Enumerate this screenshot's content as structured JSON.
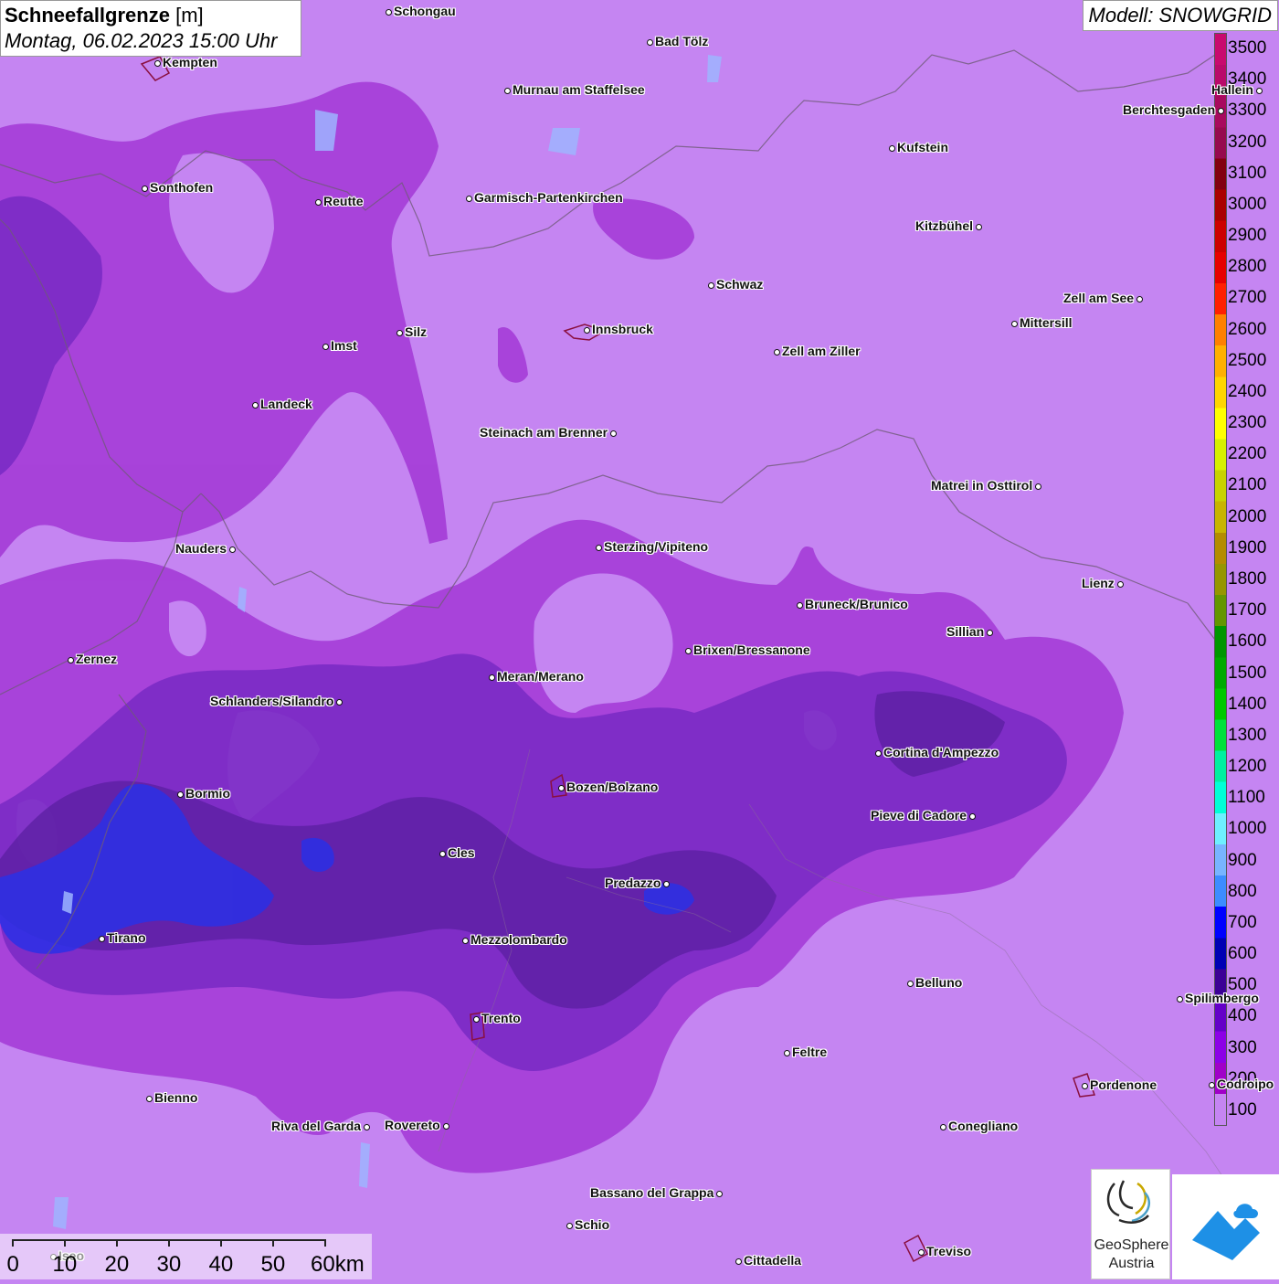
{
  "header": {
    "title": "Schneefallgrenze",
    "unit": "[m]",
    "datetime": "Montag, 06.02.2023 15:00 Uhr"
  },
  "model": {
    "label": "Modell: SNOWGRID"
  },
  "legend": {
    "levels": [
      "3500",
      "3400",
      "3300",
      "3200",
      "3100",
      "3000",
      "2900",
      "2800",
      "2700",
      "2600",
      "2500",
      "2400",
      "2300",
      "2200",
      "2100",
      "2000",
      "1900",
      "1800",
      "1700",
      "1600",
      "1500",
      "1400",
      "1300",
      "1200",
      "1100",
      "1000",
      "900",
      "800",
      "700",
      "600",
      "500",
      "400",
      "300",
      "200",
      "100"
    ],
    "colors": [
      "#c80a6e",
      "#b90a6a",
      "#a80a5e",
      "#960a4e",
      "#820010",
      "#aa0000",
      "#cc0000",
      "#e60000",
      "#ff2000",
      "#ff8000",
      "#ffb000",
      "#ffd500",
      "#ffff00",
      "#d7f000",
      "#c8d200",
      "#c8b400",
      "#b48c00",
      "#969600",
      "#649600",
      "#009600",
      "#00aa00",
      "#00c800",
      "#00e13c",
      "#00f0a0",
      "#00ffd7",
      "#6ef0ff",
      "#78b4ff",
      "#3c8cff",
      "#0000ff",
      "#0000b4",
      "#3c0096",
      "#6400c8",
      "#8c00e6",
      "#a000c8",
      "#c585f2"
    ]
  },
  "cities": [
    {
      "name": "Schongau",
      "dot": "left"
    },
    {
      "name": "Bad Tölz",
      "dot": "left"
    },
    {
      "name": "Kempten",
      "dot": "left"
    },
    {
      "name": "Murnau am Staffelsee",
      "dot": "left"
    },
    {
      "name": "Hallein",
      "dot": "right"
    },
    {
      "name": "Berchtesgaden",
      "dot": "right"
    },
    {
      "name": "Kufstein",
      "dot": "left"
    },
    {
      "name": "Sonthofen",
      "dot": "left"
    },
    {
      "name": "Reutte",
      "dot": "left"
    },
    {
      "name": "Garmisch-Partenkirchen",
      "dot": "left"
    },
    {
      "name": "Kitzbühel",
      "dot": "right"
    },
    {
      "name": "Schwaz",
      "dot": "left"
    },
    {
      "name": "Zell am See",
      "dot": "right"
    },
    {
      "name": "Innsbruck",
      "dot": "left"
    },
    {
      "name": "Mittersill",
      "dot": "left"
    },
    {
      "name": "Silz",
      "dot": "left"
    },
    {
      "name": "Imst",
      "dot": "left"
    },
    {
      "name": "Zell am Ziller",
      "dot": "left"
    },
    {
      "name": "Landeck",
      "dot": "left"
    },
    {
      "name": "Steinach am Brenner",
      "dot": "right"
    },
    {
      "name": "Matrei in Osttirol",
      "dot": "right"
    },
    {
      "name": "Nauders",
      "dot": "right"
    },
    {
      "name": "Sterzing/Vipiteno",
      "dot": "left"
    },
    {
      "name": "Lienz",
      "dot": "right"
    },
    {
      "name": "Bruneck/Brunico",
      "dot": "left"
    },
    {
      "name": "Sillian",
      "dot": "right"
    },
    {
      "name": "Zernez",
      "dot": "left"
    },
    {
      "name": "Brixen/Bressanone",
      "dot": "left"
    },
    {
      "name": "Meran/Merano",
      "dot": "left"
    },
    {
      "name": "Schlanders/Silandro",
      "dot": "right"
    },
    {
      "name": "Cortina d'Ampezzo",
      "dot": "left"
    },
    {
      "name": "Bozen/Bolzano",
      "dot": "left"
    },
    {
      "name": "Bormio",
      "dot": "left"
    },
    {
      "name": "Pieve di Cadore",
      "dot": "right"
    },
    {
      "name": "Cles",
      "dot": "left"
    },
    {
      "name": "Predazzo",
      "dot": "right"
    },
    {
      "name": "Tirano",
      "dot": "left"
    },
    {
      "name": "Mezzolombardo",
      "dot": "left"
    },
    {
      "name": "Belluno",
      "dot": "left"
    },
    {
      "name": "Spilimbergo",
      "dot": "left"
    },
    {
      "name": "Trento",
      "dot": "left"
    },
    {
      "name": "Feltre",
      "dot": "left"
    },
    {
      "name": "Pordenone",
      "dot": "left"
    },
    {
      "name": "Codroipo",
      "dot": "left"
    },
    {
      "name": "Bienno",
      "dot": "left"
    },
    {
      "name": "Riva del Garda",
      "dot": "right"
    },
    {
      "name": "Rovereto",
      "dot": "right"
    },
    {
      "name": "Conegliano",
      "dot": "left"
    },
    {
      "name": "Bassano del Grappa",
      "dot": "right"
    },
    {
      "name": "Schio",
      "dot": "left"
    },
    {
      "name": "Iseo",
      "dot": "left"
    },
    {
      "name": "Treviso",
      "dot": "left"
    },
    {
      "name": "Cittadella",
      "dot": "left"
    }
  ],
  "scale": {
    "labels": [
      "0",
      "10",
      "20",
      "30",
      "40",
      "50",
      "60km"
    ]
  },
  "logos": {
    "geosphere_line1": "GeoSphere",
    "geosphere_line2": "Austria"
  }
}
